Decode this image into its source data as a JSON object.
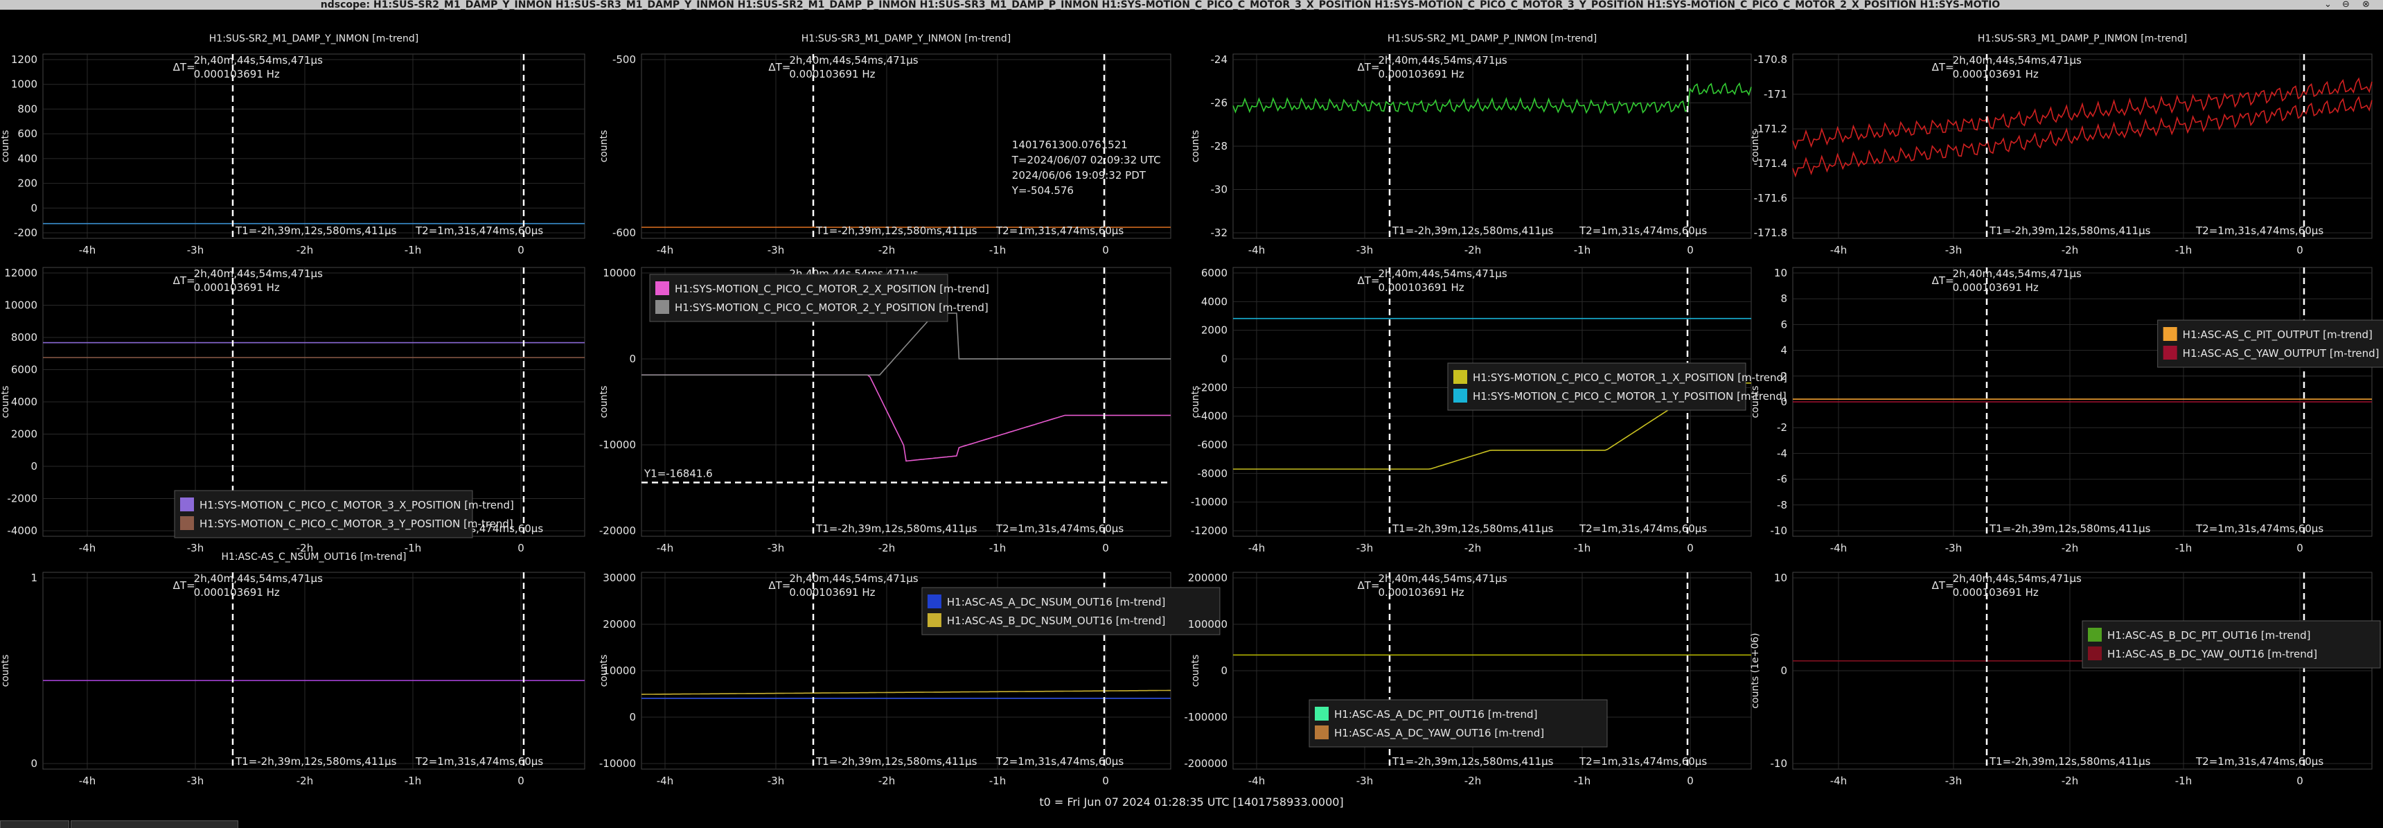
{
  "window": {
    "title": "ndscope: H1:SUS-SR2_M1_DAMP_Y_INMON H1:SUS-SR3_M1_DAMP_Y_INMON H1:SUS-SR2_M1_DAMP_P_INMON H1:SUS-SR3_M1_DAMP_P_INMON H1:SYS-MOTION_C_PICO_C_MOTOR_3_X_POSITION H1:SYS-MOTION_C_PICO_C_MOTOR_3_Y_POSITION H1:SYS-MOTION_C_PICO_C_MOTOR_2_X_POSITION H1:SYS-MOTIO",
    "controls": {
      "minimize": "⌄",
      "restore": "⊖",
      "close": "⊗"
    }
  },
  "cursors": {
    "delta_label": "ΔT=",
    "delta_time": "2h,40m,44s,54ms,471μs",
    "delta_freq": "0.000103691 Hz",
    "t1": "T1=-2h,39m,12s,580ms,411μs",
    "t2": "T2=1m,31s,474ms,60μs"
  },
  "footer": {
    "t0": "t0 = Fri Jun 07 2024 01:28:35 UTC [1401758933.0000]"
  },
  "plots": [
    {
      "title": "H1:SUS-SR2_M1_DAMP_Y_INMON [m-trend]",
      "ylabel": "counts",
      "yticks": [
        "1200",
        "1000",
        "800",
        "600",
        "400",
        "200",
        "0",
        "-200"
      ],
      "xticks": [
        "-4h",
        "-3h",
        "-2h",
        "-1h",
        "0"
      ],
      "legend": []
    },
    {
      "title": "H1:SUS-SR3_M1_DAMP_Y_INMON [m-trend]",
      "ylabel": "counts",
      "yticks": [
        "-500",
        "-600"
      ],
      "xticks": [
        "-4h",
        "-3h",
        "-2h",
        "-1h",
        "0"
      ],
      "legend": [],
      "cursor_readout": [
        "1401761300.0761521",
        "T=2024/06/07 02:09:32 UTC",
        "2024/06/06 19:09:32 PDT",
        "Y=-504.576"
      ]
    },
    {
      "title": "H1:SUS-SR2_M1_DAMP_P_INMON [m-trend]",
      "ylabel": "counts",
      "yticks": [
        "-24",
        "-26",
        "-28",
        "-30",
        "-32"
      ],
      "xticks": [
        "-4h",
        "-3h",
        "-2h",
        "-1h",
        "0"
      ],
      "legend": []
    },
    {
      "title": "H1:SUS-SR3_M1_DAMP_P_INMON [m-trend]",
      "ylabel": "counts",
      "yticks": [
        "-170.8",
        "-171",
        "-171.2",
        "-171.4",
        "-171.6",
        "-171.8"
      ],
      "xticks": [
        "-4h",
        "-3h",
        "-2h",
        "-1h",
        "0"
      ],
      "legend": []
    },
    {
      "title": "",
      "ylabel": "counts",
      "yticks": [
        "12000",
        "10000",
        "8000",
        "6000",
        "4000",
        "2000",
        "0",
        "-2000",
        "-4000"
      ],
      "xticks": [
        "-4h",
        "-3h",
        "-2h",
        "-1h",
        "0"
      ],
      "legend": [
        {
          "label": "H1:SYS-MOTION_C_PICO_C_MOTOR_3_X_POSITION [m-trend]",
          "color": "#8c6ad8"
        },
        {
          "label": "H1:SYS-MOTION_C_PICO_C_MOTOR_3_Y_POSITION [m-trend]",
          "color": "#8c5a48"
        }
      ]
    },
    {
      "title": "",
      "ylabel": "counts",
      "yticks": [
        "10000",
        "0",
        "-10000",
        "-20000"
      ],
      "xticks": [
        "-4h",
        "-3h",
        "-2h",
        "-1h",
        "0"
      ],
      "legend": [
        {
          "label": "H1:SYS-MOTION_C_PICO_C_MOTOR_2_X_POSITION [m-trend]",
          "color": "#e85ad0"
        },
        {
          "label": "H1:SYS-MOTION_C_PICO_C_MOTOR_2_Y_POSITION [m-trend]",
          "color": "#8a8a8a"
        }
      ],
      "hcursor": "Y1=-16841.6"
    },
    {
      "title": "",
      "ylabel": "counts",
      "yticks": [
        "6000",
        "4000",
        "2000",
        "0",
        "-2000",
        "-4000",
        "-6000",
        "-8000",
        "-10000",
        "-12000"
      ],
      "xticks": [
        "-4h",
        "-3h",
        "-2h",
        "-1h",
        "0"
      ],
      "legend": [
        {
          "label": "H1:SYS-MOTION_C_PICO_C_MOTOR_1_X_POSITION [m-trend]",
          "color": "#c8c020"
        },
        {
          "label": "H1:SYS-MOTION_C_PICO_C_MOTOR_1_Y_POSITION [m-trend]",
          "color": "#18b4d8"
        }
      ]
    },
    {
      "title": "",
      "ylabel": "counts",
      "yticks": [
        "10",
        "8",
        "6",
        "4",
        "2",
        "0",
        "-2",
        "-4",
        "-6",
        "-8",
        "-10"
      ],
      "xticks": [
        "-4h",
        "-3h",
        "-2h",
        "-1h",
        "0"
      ],
      "legend": [
        {
          "label": "H1:ASC-AS_C_PIT_OUTPUT [m-trend]",
          "color": "#f0a030"
        },
        {
          "label": "H1:ASC-AS_C_YAW_OUTPUT [m-trend]",
          "color": "#a01030"
        }
      ]
    },
    {
      "title": "H1:ASC-AS_C_NSUM_OUT16 [m-trend]",
      "ylabel": "counts",
      "yticks": [
        "1",
        "0"
      ],
      "xticks": [
        "-4h",
        "-3h",
        "-2h",
        "-1h",
        "0"
      ],
      "legend": []
    },
    {
      "title": "",
      "ylabel": "counts",
      "yticks": [
        "30000",
        "20000",
        "10000",
        "0",
        "-10000"
      ],
      "xticks": [
        "-4h",
        "-3h",
        "-2h",
        "-1h",
        "0"
      ],
      "legend": [
        {
          "label": "H1:ASC-AS_A_DC_NSUM_OUT16 [m-trend]",
          "color": "#2040d0"
        },
        {
          "label": "H1:ASC-AS_B_DC_NSUM_OUT16 [m-trend]",
          "color": "#c8b030"
        }
      ]
    },
    {
      "title": "",
      "ylabel": "counts",
      "yticks": [
        "200000",
        "100000",
        "0",
        "-100000",
        "-200000"
      ],
      "xticks": [
        "-4h",
        "-3h",
        "-2h",
        "-1h",
        "0"
      ],
      "legend": [
        {
          "label": "H1:ASC-AS_A_DC_PIT_OUT16 [m-trend]",
          "color": "#40f0a0"
        },
        {
          "label": "H1:ASC-AS_A_DC_YAW_OUT16 [m-trend]",
          "color": "#b87838"
        }
      ]
    },
    {
      "title": "",
      "ylabel": "counts (1e+06)",
      "yticks": [
        "10",
        "0",
        "-10"
      ],
      "xticks": [
        "-4h",
        "-3h",
        "-2h",
        "-1h",
        "0"
      ],
      "legend": [
        {
          "label": "H1:ASC-AS_B_DC_PIT_OUT16 [m-trend]",
          "color": "#50a020"
        },
        {
          "label": "H1:ASC-AS_B_DC_YAW_OUT16 [m-trend]",
          "color": "#801020"
        }
      ]
    }
  ],
  "colors": {
    "background": "#000000",
    "grid": "#2a2a2a",
    "axis": "#bbbbbb",
    "cursor": "#ffffff"
  }
}
